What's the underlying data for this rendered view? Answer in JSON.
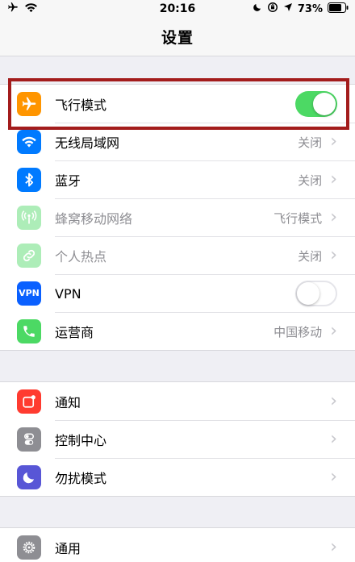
{
  "status_bar": {
    "time": "20:16",
    "battery": "73%"
  },
  "nav": {
    "title": "设置"
  },
  "group1": [
    {
      "name": "airplane",
      "label": "飞行模式",
      "icon": "airplane-icon",
      "color": "#ff9500",
      "toggle": "on"
    },
    {
      "name": "wifi",
      "label": "无线局域网",
      "icon": "wifi-icon",
      "color": "#007aff",
      "value": "关闭"
    },
    {
      "name": "bluetooth",
      "label": "蓝牙",
      "icon": "bluetooth-icon",
      "color": "#007aff",
      "value": "关闭"
    },
    {
      "name": "cellular",
      "label": "蜂窝移动网络",
      "icon": "antenna-icon",
      "color": "#4cd964",
      "value": "飞行模式",
      "dim": true
    },
    {
      "name": "hotspot",
      "label": "个人热点",
      "icon": "link-icon",
      "color": "#4cd964",
      "value": "关闭",
      "dim": true
    },
    {
      "name": "vpn",
      "label": "VPN",
      "icon": "vpn-icon",
      "icon_text": "VPN",
      "color": "#0a60ff",
      "toggle": "off"
    },
    {
      "name": "carrier",
      "label": "运营商",
      "icon": "phone-icon",
      "color": "#4cd964",
      "value": "中国移动"
    }
  ],
  "group2": [
    {
      "name": "notifications",
      "label": "通知",
      "icon": "notification-icon",
      "color": "#ff3b30"
    },
    {
      "name": "control-center",
      "label": "控制中心",
      "icon": "switches-icon",
      "color": "#8e8e93"
    },
    {
      "name": "dnd",
      "label": "勿扰模式",
      "icon": "moon-icon",
      "color": "#5856d6"
    }
  ],
  "group3": [
    {
      "name": "general",
      "label": "通用",
      "icon": "gear-icon",
      "color": "#8e8e93"
    }
  ],
  "colors": {
    "toggle_on": "#4cd964",
    "highlight": "#a31c1c",
    "background": "#efeff4"
  }
}
